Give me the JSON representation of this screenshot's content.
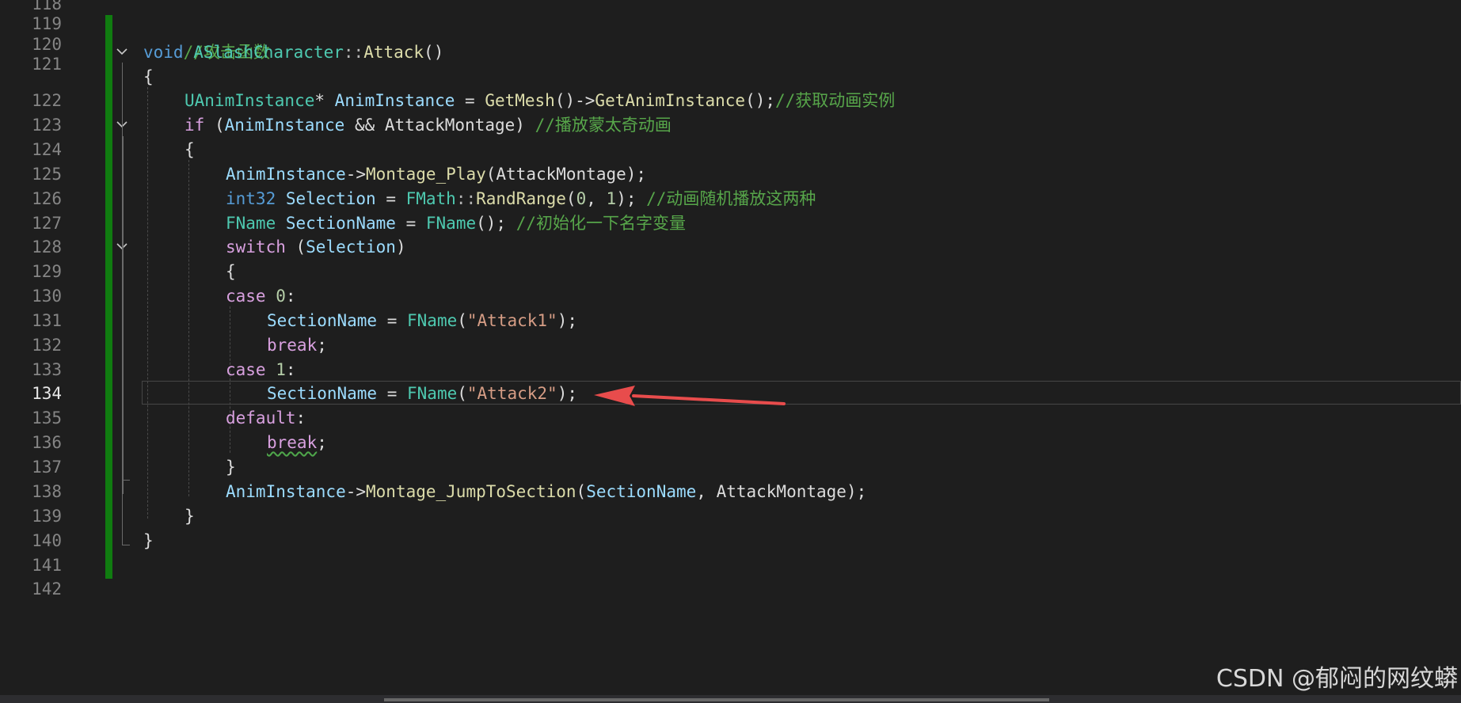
{
  "watermark": "CSDN @郁闷的网纹蟒",
  "line_numbers": [
    "118",
    "119",
    "120",
    "121",
    "122",
    "123",
    "124",
    "125",
    "126",
    "127",
    "128",
    "129",
    "130",
    "131",
    "132",
    "133",
    "134",
    "135",
    "136",
    "137",
    "138",
    "139",
    "140",
    "141",
    "142"
  ],
  "active_line": "134",
  "code": {
    "l119": {
      "c1": "//攻击函数"
    },
    "l120": {
      "t1": "void",
      "t2": "ASlashCharacter",
      "t3": "::",
      "t4": "Attack",
      "t5": "()"
    },
    "l121": {
      "t1": "{"
    },
    "l122": {
      "t1": "UAnimInstance",
      "t2": "* ",
      "t3": "AnimInstance",
      "t4": " = ",
      "t5": "GetMesh",
      "t6": "()->",
      "t7": "GetAnimInstance",
      "t8": "();",
      "t9": "//获取动画实例"
    },
    "l123": {
      "t1": "if",
      "t2": " (",
      "t3": "AnimInstance",
      "t4": " && ",
      "t5": "AttackMontage",
      "t6": ") ",
      "t7": "//播放蒙太奇动画"
    },
    "l124": {
      "t1": "{"
    },
    "l125": {
      "t1": "AnimInstance",
      "t2": "->",
      "t3": "Montage_Play",
      "t4": "(",
      "t5": "AttackMontage",
      "t6": ");"
    },
    "l126": {
      "t1": "int32",
      "t2": " ",
      "t3": "Selection",
      "t4": " = ",
      "t5": "FMath",
      "t6": "::",
      "t7": "RandRange",
      "t8": "(",
      "t9": "0",
      "t10": ", ",
      "t11": "1",
      "t12": "); ",
      "t13": "//动画随机播放这两种"
    },
    "l127": {
      "t1": "FName",
      "t2": " ",
      "t3": "SectionName",
      "t4": " = ",
      "t5": "FName",
      "t6": "(); ",
      "t7": "//初始化一下名字变量"
    },
    "l128": {
      "t1": "switch",
      "t2": " (",
      "t3": "Selection",
      "t4": ")"
    },
    "l129": {
      "t1": "{"
    },
    "l130": {
      "t1": "case",
      "t2": " ",
      "t3": "0",
      "t4": ":"
    },
    "l131": {
      "t1": "SectionName",
      "t2": " = ",
      "t3": "FName",
      "t4": "(",
      "t5": "\"Attack1\"",
      "t6": ");"
    },
    "l132": {
      "t1": "break",
      "t2": ";"
    },
    "l133": {
      "t1": "case",
      "t2": " ",
      "t3": "1",
      "t4": ":"
    },
    "l134": {
      "t1": "SectionName",
      "t2": " = ",
      "t3": "FName",
      "t4": "(",
      "t5": "\"Attack2\"",
      "t6": ");"
    },
    "l135": {
      "t1": "default",
      "t2": ":"
    },
    "l136": {
      "t1": "break",
      "t2": ";"
    },
    "l137": {
      "t1": "}"
    },
    "l138": {
      "t1": "AnimInstance",
      "t2": "->",
      "t3": "Montage_JumpToSection",
      "t4": "(",
      "t5": "SectionName",
      "t6": ", ",
      "t7": "AttackMontage",
      "t8": ");"
    },
    "l139": {
      "t1": "}"
    },
    "l140": {
      "t1": "}"
    }
  },
  "fold_icons": {
    "collapse": "chevron-down"
  },
  "colors": {
    "background": "#1e1e1e",
    "change_bar": "#107c10",
    "arrow": "#e84c4c",
    "keyword": "#569cd6",
    "control_keyword": "#d8a0df",
    "type": "#4ec9b0",
    "variable": "#9cdcfe",
    "function": "#dcdcaa",
    "string": "#d69d85",
    "comment": "#57a64a"
  }
}
